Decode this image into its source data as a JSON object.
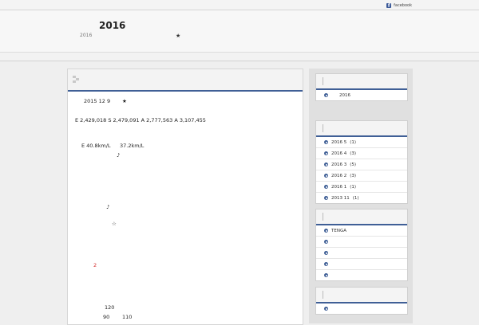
{
  "topbar": {
    "facebook_label": "facebook"
  },
  "header": {
    "title": "2016",
    "description": "2016",
    "star": "★"
  },
  "post": {
    "lines": [
      "2015 12 9",
      "★",
      "E  2,429,018  S  2,479,091  A  2,777,563  A      3,107,455",
      "E    40.8km/L",
      "37.2km/L",
      "♪",
      "♪",
      "☆",
      "2",
      "120",
      "90",
      "110"
    ],
    "highlight_color": "#d42b2b"
  },
  "sidebar": {
    "widget1": {
      "items": [
        {
          "label": "2016"
        }
      ]
    },
    "widget2": {
      "items": [
        {
          "label": "2016 5",
          "count": "(1)"
        },
        {
          "label": "2016 4",
          "count": "(3)"
        },
        {
          "label": "2016 3",
          "count": "(5)"
        },
        {
          "label": "2016 2",
          "count": "(3)"
        },
        {
          "label": "2016 1",
          "count": "(1)"
        },
        {
          "label": "2013 11",
          "count": "(1)"
        }
      ]
    },
    "widget3": {
      "items": [
        {
          "label": "TENGA"
        },
        {
          "label": ""
        },
        {
          "label": ""
        },
        {
          "label": ""
        },
        {
          "label": ""
        }
      ]
    },
    "widget4": {
      "items": [
        {
          "label": ""
        }
      ]
    }
  },
  "colors": {
    "accent": "#3f5f96",
    "facebook": "#3b5998"
  }
}
